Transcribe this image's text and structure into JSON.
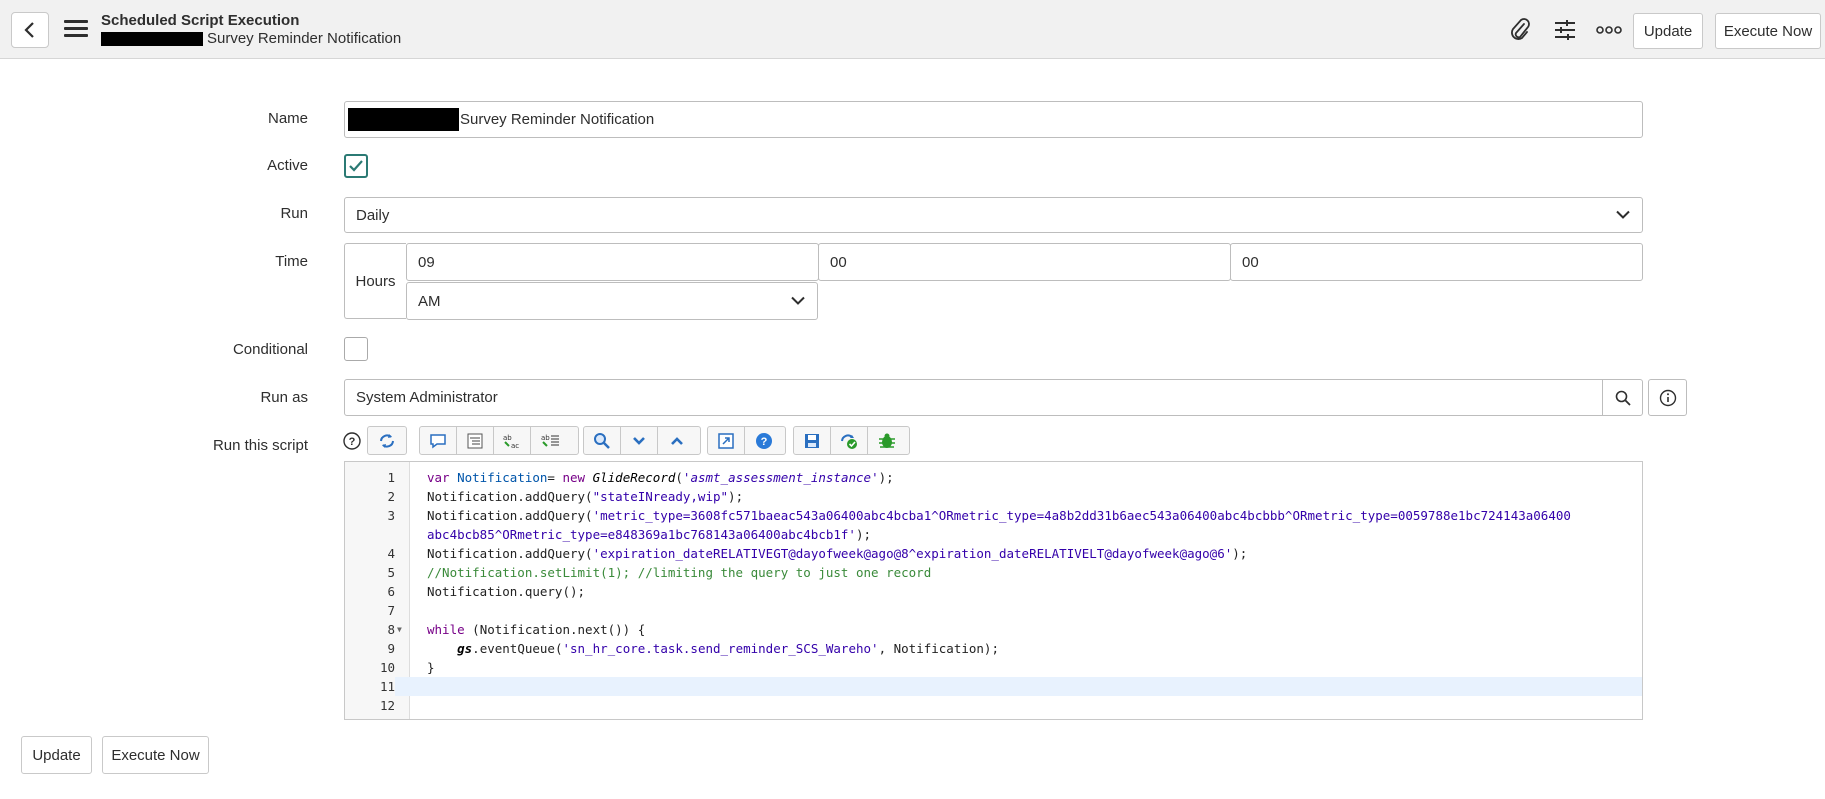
{
  "header": {
    "title": "Scheduled Script Execution",
    "subtitle": "Survey Reminder Notification",
    "update_label": "Update",
    "execute_label": "Execute Now",
    "icons": [
      "back-icon",
      "hamburger-icon",
      "paperclip-icon",
      "sliders-icon",
      "more-icon"
    ]
  },
  "form": {
    "name": {
      "label": "Name",
      "value": "Survey Reminder Notification"
    },
    "active": {
      "label": "Active",
      "checked": true
    },
    "run": {
      "label": "Run",
      "value": "Daily"
    },
    "time": {
      "label": "Time",
      "unit_label": "Hours",
      "hours": "09",
      "minutes": "00",
      "seconds": "00",
      "ampm": "AM"
    },
    "conditional": {
      "label": "Conditional",
      "checked": false
    },
    "run_as": {
      "label": "Run as",
      "value": "System Administrator"
    },
    "script": {
      "label": "Run this script"
    }
  },
  "editor": {
    "line_numbers": [
      "1",
      "2",
      "3",
      "",
      "4",
      "5",
      "6",
      "7",
      "8",
      "9",
      "10",
      "11",
      "12"
    ]
  },
  "footer": {
    "update_label": "Update",
    "execute_label": "Execute Now"
  },
  "colors": {
    "header_bg": "#f1f1f1",
    "check_accent": "#2b7a74",
    "keyword": "#770088",
    "string": "#3300aa",
    "comment": "#3a8a3a"
  }
}
